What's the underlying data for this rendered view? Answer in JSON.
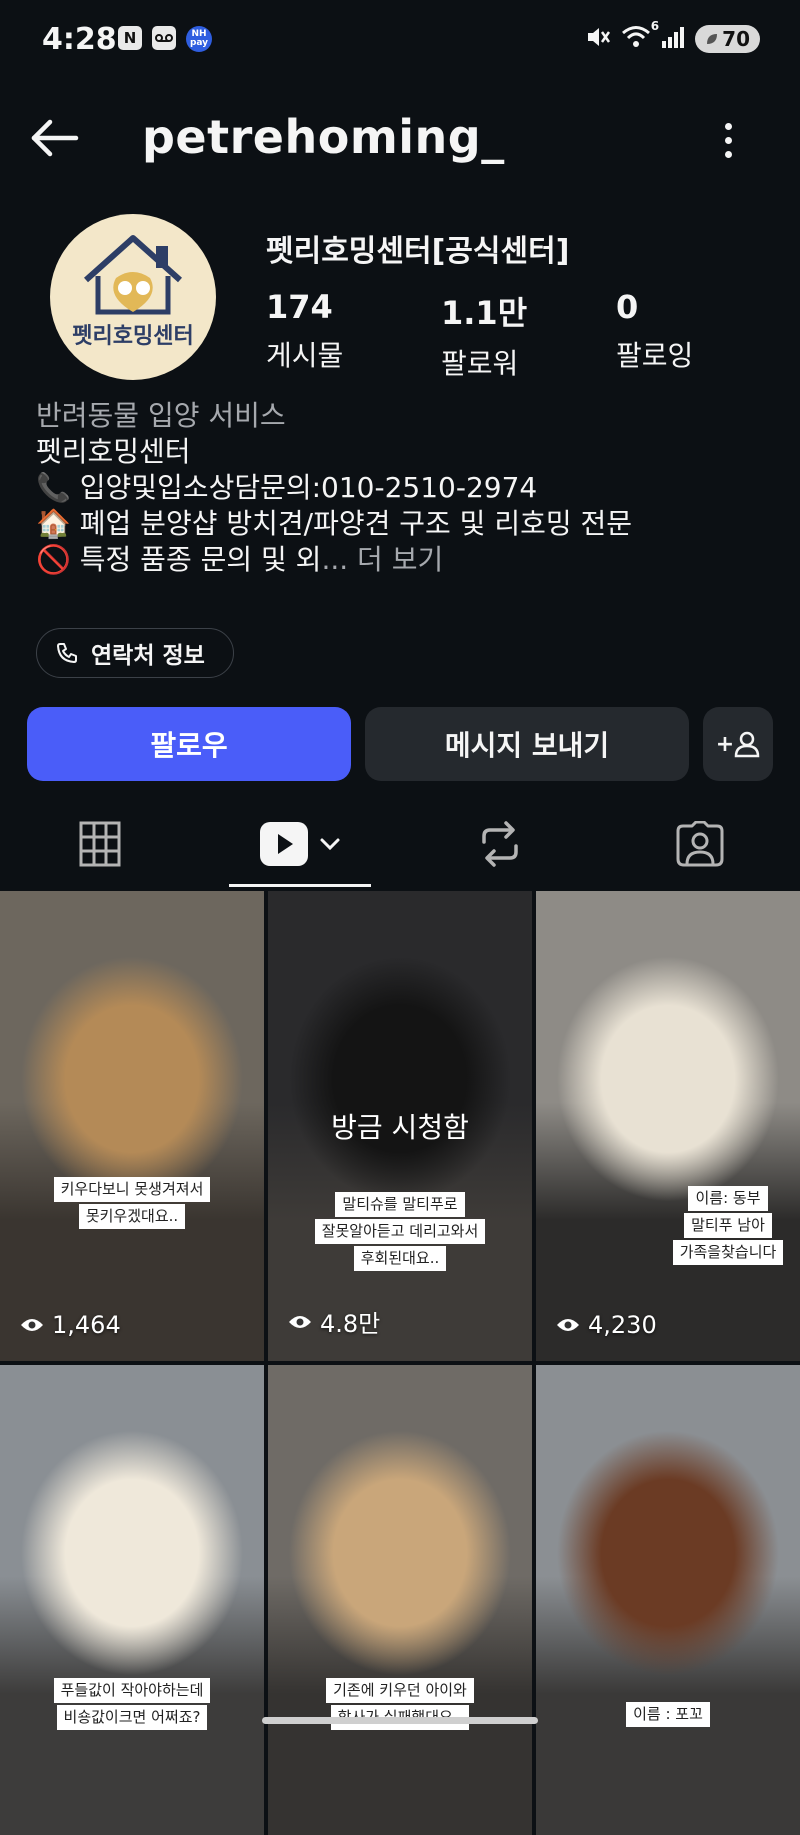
{
  "status": {
    "time": "4:28",
    "left_icons": [
      "n-icon",
      "voicemail-icon",
      "nh-pay-icon"
    ],
    "nh_label": "NH pay",
    "n_label": "N",
    "wifi_badge": "6",
    "battery": "70"
  },
  "header": {
    "username": "petrehoming_"
  },
  "profile": {
    "display_name": "펫리호밍센터[공식센터]",
    "avatar_text": "펫리호밍센터",
    "stats": [
      {
        "value": "174",
        "label": "게시물"
      },
      {
        "value": "1.1만",
        "label": "팔로워"
      },
      {
        "value": "0",
        "label": "팔로잉"
      }
    ],
    "category": "반려동물 입양 서비스",
    "bio_lines": [
      "펫리호밍센터",
      "📞 입양및입소상담문의:010-2510-2974",
      "🏠 폐업 분양샵 방치견/파양견 구조 및 리호밍 전문",
      "🚫 특정 품종 문의 및 외"
    ],
    "more_label": "... 더 보기",
    "contact_label": "연락처 정보"
  },
  "actions": {
    "follow_label": "팔로우",
    "message_label": "메시지 보내기",
    "add_user_label": "+"
  },
  "tabs": [
    "grid-icon",
    "reels-icon",
    "reposts-icon",
    "tagged-icon"
  ],
  "reels": [
    {
      "views": "1,464",
      "caption": [
        "키우다보니 못생겨져서",
        "못키우겠대요.."
      ],
      "colors": [
        "#6d675e",
        "#b48a57",
        "#3a3530"
      ]
    },
    {
      "views": "4.8만",
      "caption": [
        "말티슈를 말티푸로",
        "잘못알아듣고 데리고와서",
        "후회된대요.."
      ],
      "watched": "방금 시청함",
      "colors": [
        "#2a2a2c",
        "#141414",
        "#3e3b38"
      ]
    },
    {
      "views": "4,230",
      "caption": [
        "이름: 동부",
        "말티푸 남아",
        "가족을찾습니다"
      ],
      "colors": [
        "#8e8b86",
        "#e8e1d3",
        "#2c2b2a"
      ]
    },
    {
      "views": "",
      "caption": [
        "푸들값이 작아야하는데",
        "비숑값이크면 어쩌죠?"
      ],
      "colors": [
        "#8a8f94",
        "#efe8da",
        "#3d3c3b"
      ]
    },
    {
      "views": "",
      "caption": [
        "기존에 키우던 아이와",
        "합사가 실패했대요.."
      ],
      "colors": [
        "#6f6b66",
        "#c9a67a",
        "#353331"
      ]
    },
    {
      "views": "",
      "caption": [
        "이름 : 포꼬"
      ],
      "colors": [
        "#8b8f93",
        "#6b3b24",
        "#3a3938"
      ]
    }
  ]
}
